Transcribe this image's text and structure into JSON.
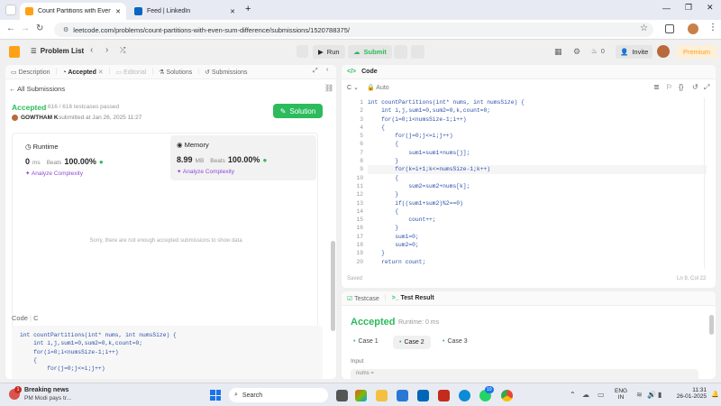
{
  "browser": {
    "tabs": [
      {
        "title": "Count Partitions with Even Sum",
        "active": true
      },
      {
        "title": "Feed | LinkedIn",
        "active": false
      }
    ],
    "url": "leetcode.com/problems/count-partitions-with-even-sum-difference/submissions/1520788375/"
  },
  "lc_header": {
    "problem_list": "Problem List",
    "run": "Run",
    "submit": "Submit",
    "fire_count": "0",
    "invite": "Invite",
    "premium": "Premium"
  },
  "left_tabs": [
    "Description",
    "Accepted",
    "Editorial",
    "Solutions",
    "Submissions"
  ],
  "submission": {
    "back": "All Submissions",
    "status": "Accepted",
    "testcases": "616 / 616 testcases passed",
    "user": "GOWTHAM K",
    "submitted": "submitted at Jan 26, 2025 11:27",
    "solution_btn": "Solution",
    "runtime_label": "Runtime",
    "runtime_value": "0",
    "runtime_unit": "ms",
    "beats": "Beats",
    "runtime_beats": "100.00%",
    "memory_label": "Memory",
    "memory_value": "8.99",
    "memory_unit": "MB",
    "memory_beats": "100.00%",
    "analyze": "Analyze Complexity",
    "not_enough": "Sorry, there are not enough accepted submissions to show data",
    "code_label": "Code",
    "code_lang": "C"
  },
  "preview_code": [
    "int countPartitions(int* nums, int numsSize) {",
    "    int i,j,sum1=0,sum2=0,k,count=0;",
    "    for(i=0;i<numsSize-1;i++)",
    "    {",
    "        for(j=0;j<=i;j++)"
  ],
  "editor": {
    "title": "Code",
    "lang": "C",
    "mode": "Auto",
    "status": "Saved",
    "cursor": "Ln 9, Col 22",
    "lines": [
      "int countPartitions(int* nums, int numsSize) {",
      "    int i,j,sum1=0,sum2=0,k,count=0;",
      "    for(i=0;i<numsSize-1;i++)",
      "    {",
      "        for(j=0;j<=i;j++)",
      "        {",
      "            sum1=sum1+nums[j];",
      "        }",
      "        for(k=i+1;k<=numsSize-1;k++)",
      "        {",
      "            sum2=sum2+nums[k];",
      "        }",
      "        if((sum1+sum2)%2==0)",
      "        {",
      "            count++;",
      "        }",
      "        sum1=0;",
      "        sum2=0;",
      "    }",
      "    return count;"
    ]
  },
  "testpanel": {
    "tab1": "Testcase",
    "tab2": "Test Result",
    "result": "Accepted",
    "runtime": "Runtime: 0 ms",
    "cases": [
      "Case 1",
      "Case 2",
      "Case 3"
    ],
    "input_label": "Input",
    "input_var": "nums ="
  },
  "taskbar": {
    "news_title": "Breaking news",
    "news_sub": "PM Modi pays tr...",
    "news_badge": "1",
    "search": "Search",
    "lang1": "ENG",
    "lang2": "IN",
    "time": "11:31",
    "date": "26-01-2025",
    "whatsapp_badge": "10"
  },
  "colors": {
    "accent_green": "#2cbb5d",
    "premium": "#ffa116",
    "accepted": "#2cbb5d"
  }
}
